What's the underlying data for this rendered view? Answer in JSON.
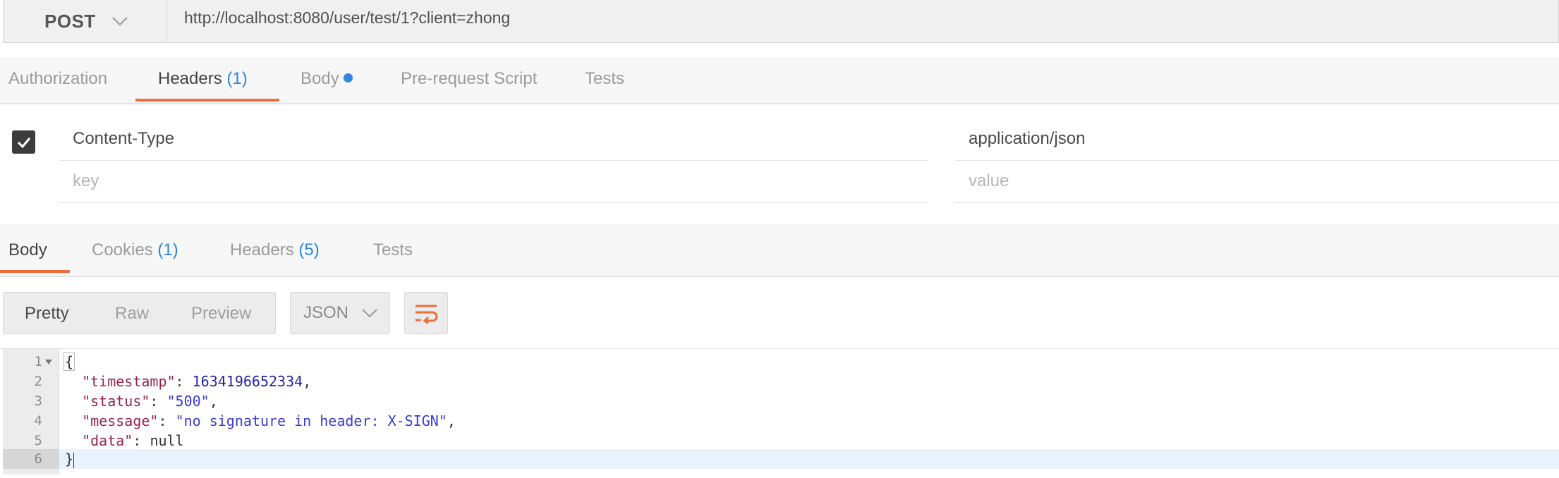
{
  "request": {
    "method": "POST",
    "url": "http://localhost:8080/user/test/1?client=zhong"
  },
  "request_tabs": {
    "authorization": "Authorization",
    "headers": "Headers",
    "headers_count": "(1)",
    "body": "Body",
    "prerequest": "Pre-request Script",
    "tests": "Tests"
  },
  "headers_table": {
    "rows": [
      {
        "key": "Content-Type",
        "value": "application/json",
        "checked": true
      }
    ],
    "key_placeholder": "key",
    "value_placeholder": "value"
  },
  "response_tabs": {
    "body": "Body",
    "cookies": "Cookies",
    "cookies_count": "(1)",
    "headers": "Headers",
    "headers_count": "(5)",
    "tests": "Tests"
  },
  "response_toolbar": {
    "pretty": "Pretty",
    "raw": "Raw",
    "preview": "Preview",
    "format": "JSON"
  },
  "response_body": {
    "line_numbers": [
      "1",
      "2",
      "3",
      "4",
      "5",
      "6"
    ],
    "open_brace": "{",
    "close_brace": "}",
    "fields": [
      {
        "key": "\"timestamp\"",
        "value": "1634196652334",
        "type": "number",
        "comma": ","
      },
      {
        "key": "\"status\"",
        "value": "\"500\"",
        "type": "string",
        "comma": ","
      },
      {
        "key": "\"message\"",
        "value": "\"no signature in header: X-SIGN\"",
        "type": "string",
        "comma": ","
      },
      {
        "key": "\"data\"",
        "value": "null",
        "type": "null",
        "comma": ""
      }
    ]
  },
  "colors": {
    "accent": "#f26b3a",
    "count_blue": "#2e86de"
  }
}
